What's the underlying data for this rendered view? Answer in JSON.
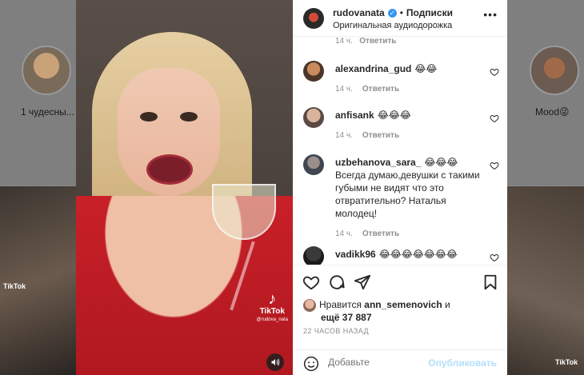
{
  "background": {
    "left_story_label": "1 чудесны...",
    "right_story_label": "Mood😜",
    "tiktok_small": "TikTok"
  },
  "video": {
    "tiktok_label": "TikTok",
    "tiktok_user": "@rudova_nata"
  },
  "header": {
    "username": "rudovanata",
    "separator": "•",
    "follow_label": "Подписки",
    "subtitle": "Оригинальная аудиодорожка"
  },
  "comments_top_meta": {
    "time": "14 ч.",
    "reply": "Ответить"
  },
  "comments": [
    {
      "user": "alexandrina_gud",
      "text": "😂😂",
      "time": "14 ч.",
      "reply": "Ответить"
    },
    {
      "user": "anfisank",
      "text": "😂😂😂",
      "time": "14 ч.",
      "reply": "Ответить"
    },
    {
      "user": "uzbehanova_sara_",
      "text": "😂😂😂 Всегда думаю,девушки с такими губыми не видят что это отвратительно? Наталья молодец!",
      "time": "14 ч.",
      "reply": "Ответить"
    },
    {
      "user": "vadikk96",
      "text": "😂😂😂😂😂😂😂",
      "time": "",
      "reply": ""
    }
  ],
  "likes": {
    "prefix": "Нравится",
    "user": "ann_semenovich",
    "conj": "и",
    "more": "ещё 37 887"
  },
  "timestamp": "22 ЧАСОВ НАЗАД",
  "add_comment": {
    "placeholder": "Добавьте",
    "publish_label": "Опубликовать"
  },
  "colors": {
    "accent": "#3897f0",
    "publish_disabled": "#b2dffc",
    "muted": "#8e8e8e",
    "text": "#262626"
  }
}
